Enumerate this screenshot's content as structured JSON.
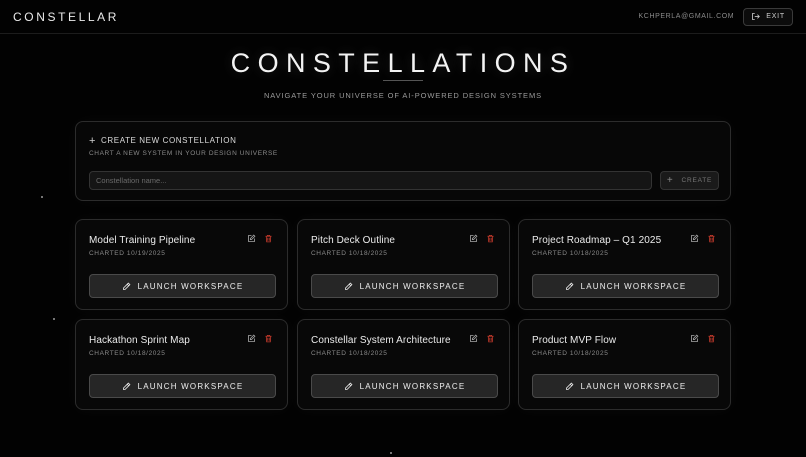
{
  "header": {
    "brand": "CONSTELLAR",
    "email": "KCHPERLA@GMAIL.COM",
    "exit_label": "EXIT"
  },
  "hero": {
    "title": "CONSTELLATIONS",
    "subtitle": "NAVIGATE YOUR UNIVERSE OF AI-POWERED DESIGN SYSTEMS"
  },
  "create_panel": {
    "title": "CREATE NEW CONSTELLATION",
    "subtitle": "CHART A NEW SYSTEM IN YOUR DESIGN UNIVERSE",
    "input_value": "",
    "input_placeholder": "Constellation name...",
    "create_label": "CREATE"
  },
  "cards": [
    {
      "title": "Model Training Pipeline",
      "date": "CHARTED 10/19/2025",
      "launch_label": "LAUNCH WORKSPACE"
    },
    {
      "title": "Pitch Deck Outline",
      "date": "CHARTED 10/18/2025",
      "launch_label": "LAUNCH WORKSPACE"
    },
    {
      "title": "Project Roadmap – Q1 2025",
      "date": "CHARTED 10/18/2025",
      "launch_label": "LAUNCH WORKSPACE"
    },
    {
      "title": "Hackathon Sprint Map",
      "date": "CHARTED 10/18/2025",
      "launch_label": "LAUNCH WORKSPACE"
    },
    {
      "title": "Constellar System Architecture",
      "date": "CHARTED 10/18/2025",
      "launch_label": "LAUNCH WORKSPACE"
    },
    {
      "title": "Product MVP Flow",
      "date": "CHARTED 10/18/2025",
      "launch_label": "LAUNCH WORKSPACE"
    }
  ],
  "icons": {
    "exit": "exit-icon",
    "plus": "plus-icon",
    "edit": "edit-icon",
    "delete": "trash-icon",
    "launch": "pencil-icon"
  },
  "colors": {
    "background": "#020202",
    "accent_delete": "#c0392b",
    "text": "#e6e6e6",
    "muted": "#8a8a8a"
  }
}
